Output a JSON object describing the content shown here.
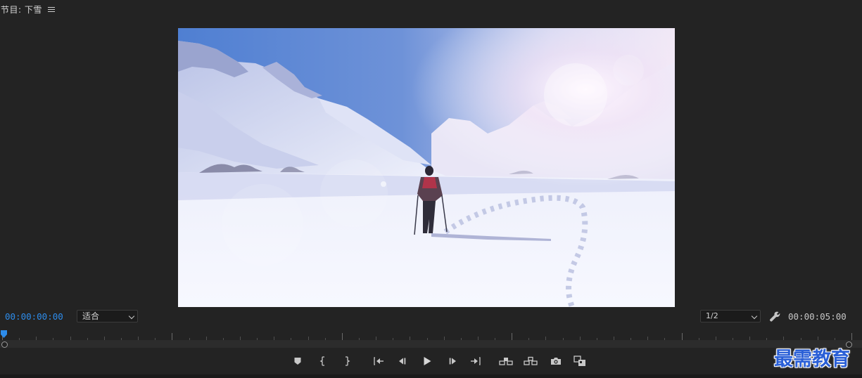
{
  "panel": {
    "title": "节目: 下雪"
  },
  "viewer": {
    "image": "snowy-mountain-hiker"
  },
  "controls": {
    "current_time": "00:00:00:00",
    "zoom_selected": "适合",
    "resolution_selected": "1/2",
    "duration": "00:00:05:00"
  },
  "transport": {
    "buttons": [
      "add-marker",
      "mark-in",
      "mark-out",
      "go-to-in",
      "step-back",
      "play",
      "step-forward",
      "go-to-out",
      "lift",
      "extract",
      "export-frame",
      "comparison-view"
    ]
  },
  "watermark": {
    "text": "最需教育"
  },
  "colors": {
    "accent_blue": "#2d8ceb",
    "panel_bg": "#232323",
    "watermark": "#2a5fd6"
  }
}
